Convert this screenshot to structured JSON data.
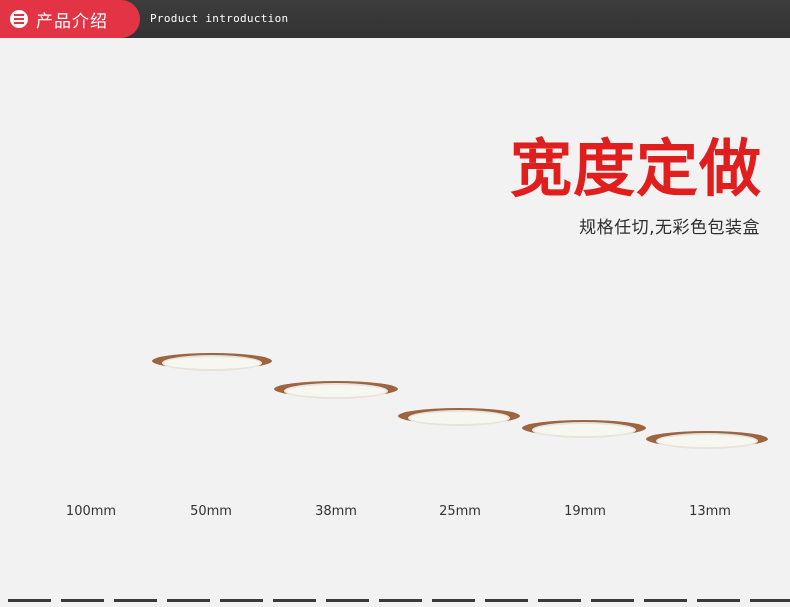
{
  "header": {
    "tag_label": "产品介绍",
    "subtitle": "Product introduction"
  },
  "headline": {
    "title": "宽度定做",
    "subtitle": "规格任切,无彩色包装盒"
  },
  "rolls": [
    {
      "label": "100mm"
    },
    {
      "label": "50mm"
    },
    {
      "label": "38mm"
    },
    {
      "label": "25mm"
    },
    {
      "label": "19mm"
    },
    {
      "label": "13mm"
    }
  ],
  "colors": {
    "accent": "#e33445",
    "title_red": "#e01e1e",
    "header_dark": "#333333",
    "tape_brown": "#a46840"
  }
}
